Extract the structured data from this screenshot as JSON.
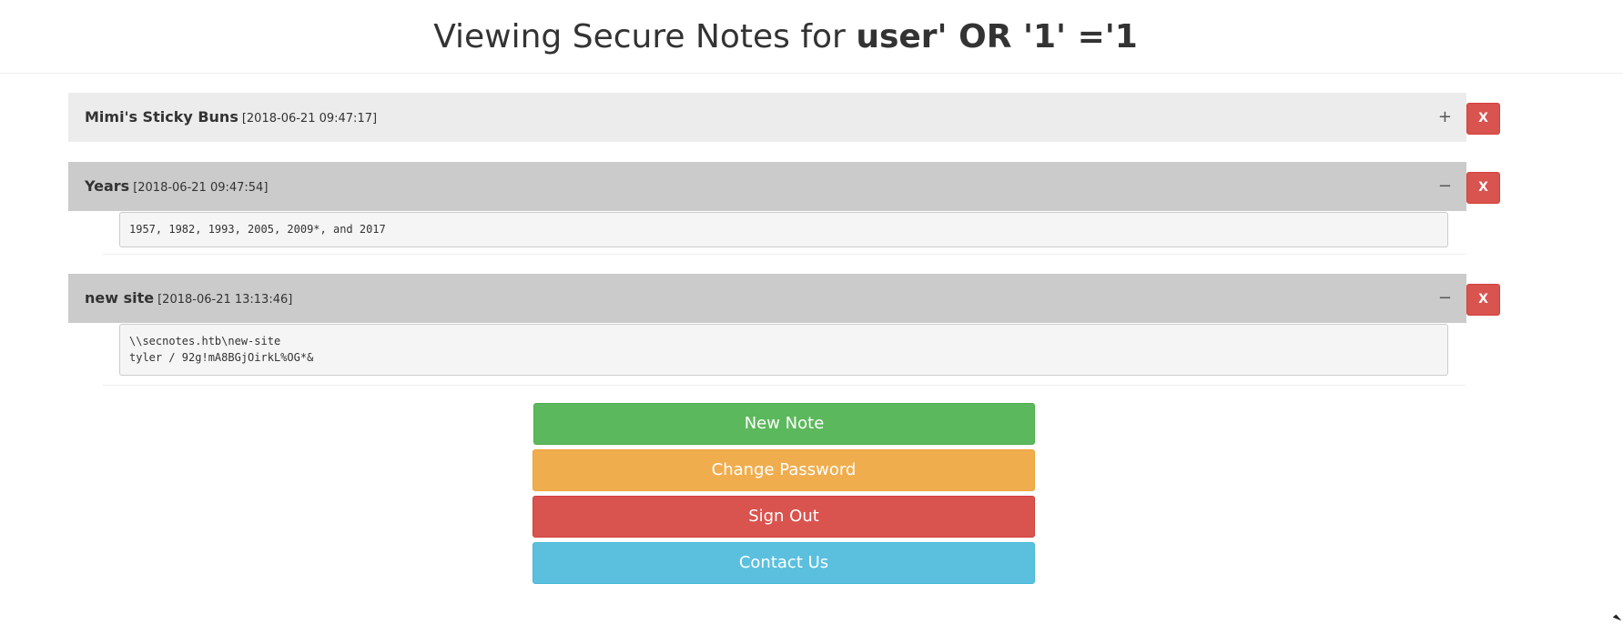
{
  "header": {
    "title_prefix": "Viewing Secure Notes for ",
    "username": "user' OR '1' ='1"
  },
  "notes": [
    {
      "title": "Mimi's Sticky Buns",
      "date": "[2018-06-21 09:47:17]",
      "state": "collapsed",
      "toggle_icon": "+",
      "delete_label": "X",
      "body": ""
    },
    {
      "title": "Years",
      "date": "[2018-06-21 09:47:54]",
      "state": "expanded",
      "toggle_icon": "−",
      "delete_label": "X",
      "body": "1957, 1982, 1993, 2005, 2009*, and 2017"
    },
    {
      "title": "new site",
      "date": "[2018-06-21 13:13:46]",
      "state": "expanded",
      "toggle_icon": "−",
      "delete_label": "X",
      "body": "\\\\secnotes.htb\\new-site\ntyler / 92g!mA8BGjOirkL%OG*&"
    }
  ],
  "actions": {
    "new_note": "New Note",
    "change_password": "Change Password",
    "sign_out": "Sign Out",
    "contact_us": "Contact Us"
  },
  "colors": {
    "success": "#5cb85c",
    "warning": "#f0ad4e",
    "danger": "#d9534f",
    "info": "#5bc0de"
  }
}
